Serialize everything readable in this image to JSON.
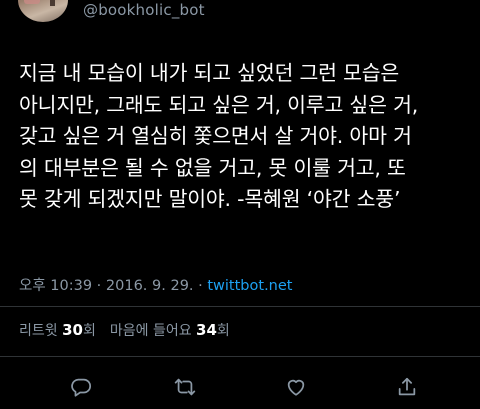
{
  "profile": {
    "handle": "@bookholic_bot"
  },
  "tweet": {
    "text_lines": [
      "지금 내 모습이 내가 되고 싶었던 그런 모습은",
      "아니지만, 그래도 되고 싶은 거, 이루고 싶은 거,",
      "갖고 싶은 거 열심히 쫓으면서 살 거야. 아마 거",
      "의 대부분은 될 수 없을 거고, 못 이룰 거고, 또",
      "못 갖게 되겠지만 말이야. -목혜원 ‘야간 소풍’"
    ],
    "time": "오후 10:39",
    "separator": " · ",
    "date": "2016. 9. 29.",
    "source": "twittbot.net"
  },
  "stats": {
    "retweets_label": "리트윗",
    "retweets_count": "30",
    "retweets_unit": "회",
    "likes_label": "마음에 들어요",
    "likes_count": "34",
    "likes_unit": "회"
  },
  "actions": {
    "icons": [
      "reply-icon",
      "retweet-icon",
      "like-icon",
      "share-icon"
    ]
  }
}
